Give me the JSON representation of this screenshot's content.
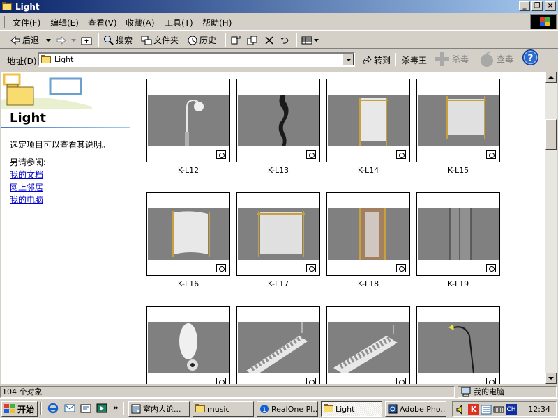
{
  "window": {
    "title": "Light"
  },
  "menu": [
    "文件(F)",
    "编辑(E)",
    "查看(V)",
    "收藏(A)",
    "工具(T)",
    "帮助(H)"
  ],
  "toolbar": {
    "back": "后退",
    "search": "搜索",
    "folders": "文件夹",
    "history": "历史"
  },
  "address": {
    "label": "地址(D)",
    "value": "Light",
    "go": "转到",
    "antivirus": "杀毒王",
    "kill": "杀毒",
    "scan": "查毒"
  },
  "left_panel": {
    "title": "Light",
    "description": "选定项目可以查看其说明。",
    "see_also": "另请参阅:",
    "links": [
      "我的文档",
      "网上邻居",
      "我的电脑"
    ]
  },
  "thumbnails": [
    {
      "label": "K-L12"
    },
    {
      "label": "K-L13"
    },
    {
      "label": "K-L14"
    },
    {
      "label": "K-L15"
    },
    {
      "label": "K-L16"
    },
    {
      "label": "K-L17"
    },
    {
      "label": "K-L18"
    },
    {
      "label": "K-L19"
    },
    {
      "label": ""
    },
    {
      "label": ""
    },
    {
      "label": ""
    },
    {
      "label": ""
    }
  ],
  "status": {
    "count": "104 个对象",
    "zone": "我的电脑"
  },
  "taskbar": {
    "start": "开始",
    "tasks": [
      "室内人论...",
      "music",
      "RealOne Pl...",
      "Light",
      "Adobe Pho..."
    ],
    "clock": "12:34",
    "tray_k": "K",
    "tray_ch": "CH"
  },
  "colors": {
    "titlebar_start": "#0a246a",
    "titlebar_end": "#a6caf0",
    "link": "#0000cc",
    "face": "#d4d0c8"
  }
}
